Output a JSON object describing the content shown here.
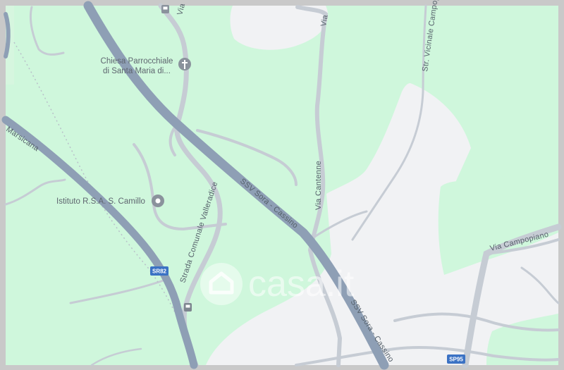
{
  "map": {
    "roads": {
      "ssv_upper": "SSV Sora - Cassino",
      "ssv_lower": "SSV Sora - Cassino",
      "marsicana": "Marsicana",
      "via_cantenne": "Via Cantenne",
      "via_top": "Via",
      "strada_comunale": "Strada Comunale Valleradice",
      "str_vicinale": "Str. Vicinale Campopia",
      "via_campopiano": "Via Campopiano",
      "via_top_right": "Via"
    },
    "shields": {
      "sr82": "SR82",
      "sp95": "SP95"
    },
    "pois": {
      "chiesa_line1": "Chiesa Parrocchiale",
      "chiesa_line2": "di Santa Maria di...",
      "istituto": "Istituto R.S.A. S. Camillo"
    },
    "watermark": "casa.it",
    "colors": {
      "vegetation": "#cff7dc",
      "urban": "#f1f2f4",
      "highway": "#8e9fb5",
      "road": "#c6ccd4",
      "shield": "#3b72c4"
    },
    "icons": [
      "church-icon",
      "poi-pin-icon",
      "bus-stop-icon",
      "watermark-house-icon"
    ]
  }
}
